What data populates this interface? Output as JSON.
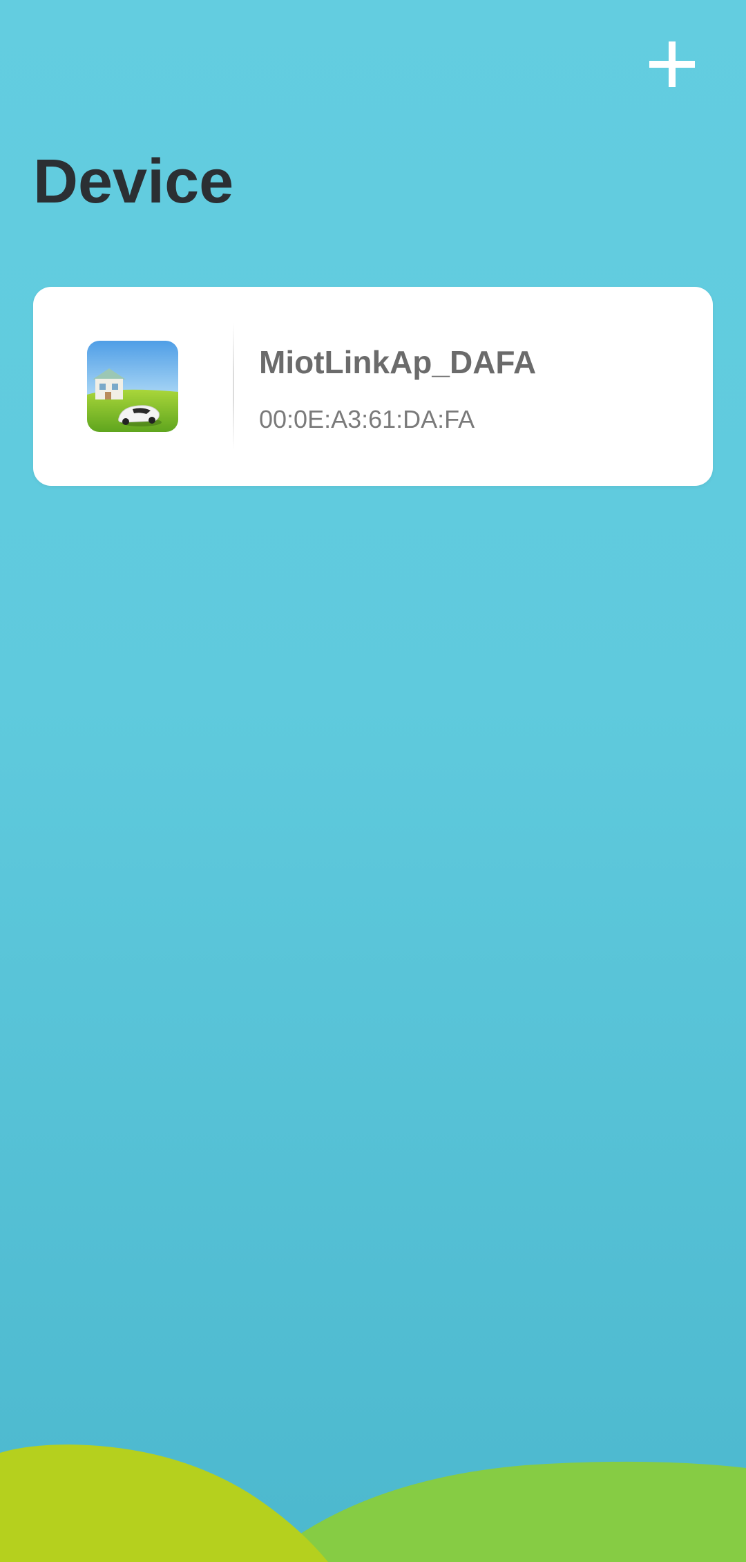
{
  "header": {
    "add_icon": "plus-icon",
    "title": "Device"
  },
  "devices": [
    {
      "name": "MiotLinkAp_DAFA",
      "mac": "00:0E:A3:61:DA:FA",
      "icon": "robot-mower-house-icon"
    }
  ],
  "colors": {
    "background_top": "#63cde0",
    "background_bottom": "#4cb8ce",
    "title": "#2b2f33",
    "card": "#ffffff",
    "hill_left": "#b5d01e",
    "hill_right": "#86cc44"
  }
}
